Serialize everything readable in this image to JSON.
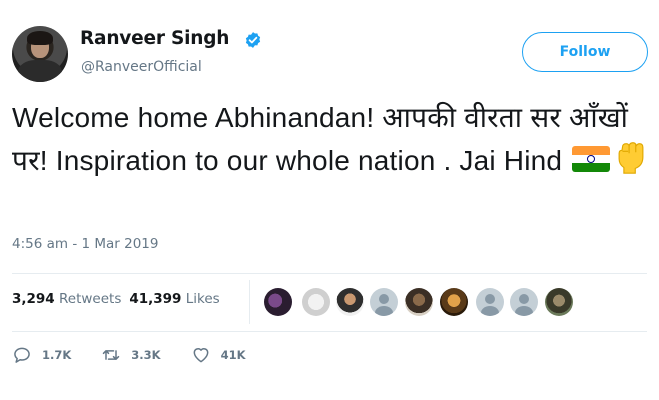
{
  "author": {
    "name": "Ranveer Singh",
    "handle": "@RanveerOfficial",
    "verified": true
  },
  "follow_button": {
    "label": "Follow"
  },
  "tweet": {
    "text": "Welcome home Abhinandan! आपकी वीरता सर आँखों पर! Inspiration to our whole nation . Jai Hind",
    "emojis": [
      "flag-india-icon",
      "raised-fist-icon"
    ],
    "timestamp": "4:56 am - 1 Mar 2019"
  },
  "stats": {
    "retweets_count": "3,294",
    "retweets_label": "Retweets",
    "likes_count": "41,399",
    "likes_label": "Likes",
    "liker_avatars": 9
  },
  "actions": {
    "reply_count": "1.7K",
    "retweet_count": "3.3K",
    "like_count": "41K"
  },
  "colors": {
    "accent": "#1da1f2",
    "muted": "#657786",
    "text": "#14171a",
    "divider": "#e6ecf0"
  }
}
